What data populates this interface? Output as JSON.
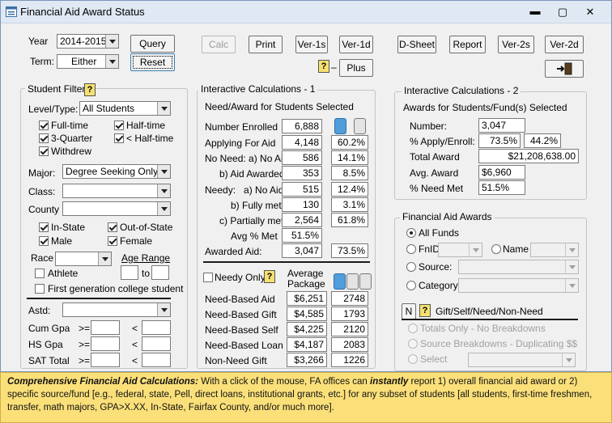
{
  "window": {
    "title": "Financial Aid Award Status",
    "min_glyph": "▬",
    "max_glyph": "▢",
    "close_glyph": "✕"
  },
  "top": {
    "year_label": "Year",
    "year_value": "2014-2015",
    "term_label": "Term:",
    "term_value": "Either",
    "query_label": "Query",
    "reset_label": "Reset",
    "calc_label": "Calc",
    "print_label": "Print",
    "ver1s_label": "Ver-1s",
    "ver1d_label": "Ver-1d",
    "dsheet_label": "D-Sheet",
    "report_label": "Report",
    "ver2s_label": "Ver-2s",
    "ver2d_label": "Ver-2d",
    "plus_label": "Plus",
    "help_glyph": "?",
    "dash": "–"
  },
  "filter": {
    "title": "Student Filter",
    "level_label": "Level/Type:",
    "level_value": "All Students",
    "fulltime": "Full-time",
    "halftime": "Half-time",
    "threequarter": "3-Quarter",
    "lthalf": "< Half-time",
    "withdrew": "Withdrew",
    "major_label": "Major:",
    "major_value": "Degree Seeking Only",
    "class_label": "Class:",
    "county_label": "County",
    "instate": "In-State",
    "outofstate": "Out-of-State",
    "male": "Male",
    "female": "Female",
    "race_label": "Race",
    "age_label": "Age Range",
    "athlete": "Athlete",
    "to": "to",
    "firstgen": "First generation college student",
    "astd_label": "Astd:",
    "cumgpa_label": "Cum Gpa",
    "hsgpa_label": "HS Gpa",
    "sat_label": "SAT Total",
    "ge": ">=",
    "lt": "<"
  },
  "calc1": {
    "title": "Interactive Calculations - 1",
    "subtitle": "Need/Award for Students Selected",
    "rows": [
      {
        "label": "Number Enrolled",
        "v1": "6,888",
        "v2": ""
      },
      {
        "label": "Applying For Aid",
        "v1": "4,148",
        "v2": "60.2%"
      },
      {
        "label": "No Need: a) No Aid",
        "v1": "586",
        "v2": "14.1%"
      },
      {
        "label": "b) Aid Awarded",
        "v1": "353",
        "v2": "8.5%"
      },
      {
        "label": "Needy:   a) No Aid",
        "v1": "515",
        "v2": "12.4%"
      },
      {
        "label": "b) Fully met",
        "v1": "130",
        "v2": "3.1%"
      },
      {
        "label": "c) Partially met",
        "v1": "2,564",
        "v2": "61.8%"
      }
    ],
    "avg_label": "Avg % Met",
    "avg_value": "51.5%",
    "awarded_label": "Awarded Aid:",
    "awarded_v1": "3,047",
    "awarded_v2": "73.5%",
    "needy_only": "Needy Only",
    "avg_pkg_1": "Average",
    "avg_pkg_2": "Package",
    "pkg_rows": [
      {
        "label": "Need-Based Aid",
        "v1": "$6,251",
        "v2": "2748"
      },
      {
        "label": "Need-Based Gift",
        "v1": "$4,585",
        "v2": "1793"
      },
      {
        "label": "Need-Based Self",
        "v1": "$4,225",
        "v2": "2120"
      },
      {
        "label": "Need-Based Loan",
        "v1": "$4,187",
        "v2": "2083"
      },
      {
        "label": "Non-Need Gift",
        "v1": "$3,266",
        "v2": "1226"
      }
    ]
  },
  "calc2": {
    "title": "Interactive Calculations - 2",
    "subtitle": "Awards for Students/Fund(s) Selected",
    "number_label": "Number:",
    "number_value": "3,047",
    "apply_label": "% Apply/Enroll:",
    "apply_v1": "73.5%",
    "apply_v2": "44.2%",
    "total_label": "Total Award",
    "total_value": "$21,208,638.00",
    "avg_label": "Avg. Award",
    "avg_value": "$6,960",
    "need_label": "% Need Met",
    "need_value": "51.5%"
  },
  "awards": {
    "title": "Financial Aid Awards",
    "allfunds": "All Funds",
    "fnid": "FnID",
    "name": "Name",
    "source": "Source:",
    "category": "Category:",
    "n_label": "N",
    "gift_label": "Gift/Self/Need/Non-Need",
    "totals_only": "Totals Only - No Breakdowns",
    "source_breakdowns": "Source Breakdowns - Duplicating $$",
    "select": "Select"
  },
  "caption": {
    "lead": "Comprehensive Financial Aid Calculations:",
    "text1": " With a click of the mouse, FA offices can ",
    "emph": "instantly",
    "text2": " report 1) overall financial aid award or 2) specific source/fund [e.g., federal, state, Pell, direct loans, institutional grants, etc.] for any subset of students [all students, first-time freshmen, transfer, math majors, GPA>X.XX, In-State, Fairfax County, and/or much more]."
  }
}
